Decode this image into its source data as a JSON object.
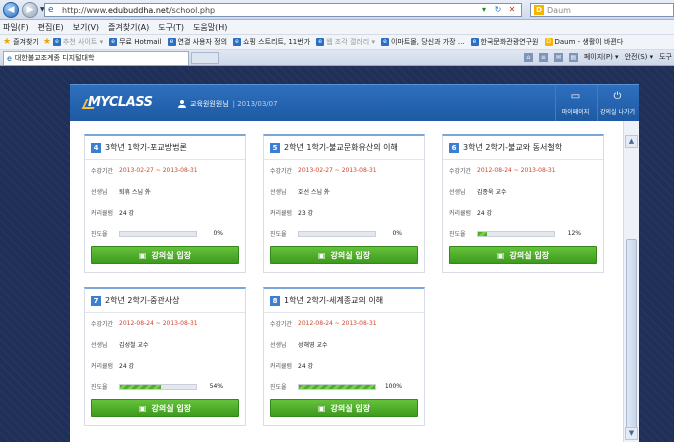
{
  "browser": {
    "url_prefix": "http://www.",
    "url_domain": "edubuddha.net",
    "url_path": "/school.php",
    "search_placeholder": "Daum",
    "menu": [
      "파일(F)",
      "편집(E)",
      "보기(V)",
      "즐겨찾기(A)",
      "도구(T)",
      "도움말(H)"
    ],
    "favorites_label": "즐겨찾기",
    "favorites": [
      {
        "label": "추천 사이트 ▾",
        "dim": true
      },
      {
        "label": "무료 Hotmail",
        "dim": false
      },
      {
        "label": "연결 사용자 정의",
        "dim": false
      },
      {
        "label": "쇼핑 스트리트, 11번가",
        "dim": false
      },
      {
        "label": "웹 조각 갤러리 ▾",
        "dim": true
      },
      {
        "label": "이마트몰, 당신과 가장 ...",
        "dim": false
      },
      {
        "label": "한국문화관광연구원",
        "dim": false
      },
      {
        "label": "Daum - 생활이 바뀐다",
        "dim": false
      }
    ],
    "tab_title": "대한불교조계종 디지털대학",
    "commands": [
      "페이지(P) ▾",
      "안전(S) ▾",
      "도구"
    ]
  },
  "header": {
    "logo": "MYCLASS",
    "user": "교육원원원님",
    "date": "| 2013/03/07",
    "mypage": "마이페이지",
    "logout": "강의실 나가기"
  },
  "labels": {
    "period": "수강기간",
    "teacher": "선생님",
    "curriculum": "커리큘럼",
    "progress": "진도율",
    "enter": "강의실 입장"
  },
  "courses": [
    {
      "num": "4",
      "title": "3학년 1학기-포교방법론",
      "period": "2013-02-27 ~ 2013-08-31",
      "teacher": "퇴휴 스님 外",
      "curriculum": "24 강",
      "progress": 0,
      "progress_label": "0%"
    },
    {
      "num": "5",
      "title": "2학년 1학기-불교문화유산의 이해",
      "period": "2013-02-27 ~ 2013-08-31",
      "teacher": "호선 스님 外",
      "curriculum": "23 강",
      "progress": 0,
      "progress_label": "0%"
    },
    {
      "num": "6",
      "title": "3학년 2학기-불교와 동서철학",
      "period": "2012-08-24 ~ 2013-08-31",
      "teacher": "김종욱 교수",
      "curriculum": "24 강",
      "progress": 12,
      "progress_label": "12%"
    },
    {
      "num": "7",
      "title": "2학년 2학기-중관사상",
      "period": "2012-08-24 ~ 2013-08-31",
      "teacher": "김성철 교수",
      "curriculum": "24 강",
      "progress": 54,
      "progress_label": "54%"
    },
    {
      "num": "8",
      "title": "1학년 2학기-세계종교의 이해",
      "period": "2012-08-24 ~ 2013-08-31",
      "teacher": "성해영 교수",
      "curriculum": "24 강",
      "progress": 100,
      "progress_label": "100%"
    }
  ],
  "colors": {
    "accent": "#2e6fbe",
    "enter_button": "#4caf28",
    "period_text": "#d0452a",
    "background": "#1f2f58"
  }
}
